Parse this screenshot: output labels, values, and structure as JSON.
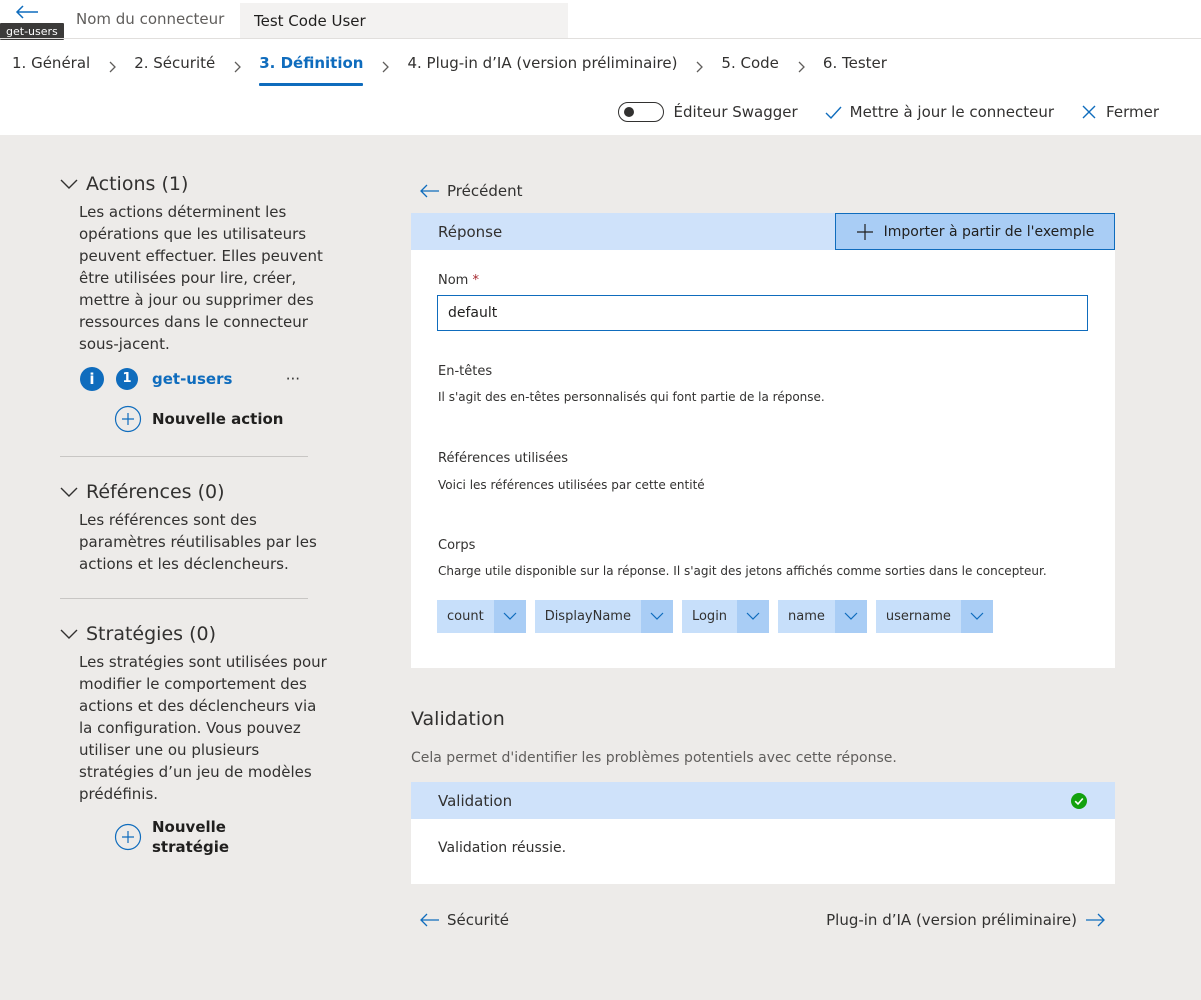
{
  "header": {
    "tooltip": "get-users",
    "connector_name_label": "Nom du connecteur",
    "connector_name_value": "Test Code User"
  },
  "steps": [
    {
      "label": "1. Général",
      "active": false
    },
    {
      "label": "2. Sécurité",
      "active": false
    },
    {
      "label": "3. Définition",
      "active": true
    },
    {
      "label": "4. Plug-in d’IA (version préliminaire)",
      "active": false
    },
    {
      "label": "5. Code",
      "active": false
    },
    {
      "label": "6. Tester",
      "active": false
    }
  ],
  "toolbar": {
    "swagger_label": "Éditeur Swagger",
    "update_label": "Mettre à jour le connecteur",
    "close_label": "Fermer"
  },
  "left": {
    "actions_title": "Actions (1)",
    "actions_desc": "Les actions déterminent les opérations que les utilisateurs peuvent effectuer. Elles peuvent être utilisées pour lire, créer, mettre à jour ou supprimer des ressources dans le connecteur sous-jacent.",
    "action_item_index": "1",
    "action_item_label": "get-users",
    "action_item_more": "···",
    "new_action_label": "Nouvelle action",
    "references_title": "Références (0)",
    "references_desc": "Les références sont des paramètres réutilisables par les actions et les déclencheurs.",
    "policies_title": "Stratégies (0)",
    "policies_desc": "Les stratégies sont utilisées pour modifier le comportement des actions et des déclencheurs via la configuration. Vous pouvez utiliser une ou plusieurs stratégies d’un jeu de modèles prédéfinis.",
    "new_policy_line1": "Nouvelle",
    "new_policy_line2": "stratégie"
  },
  "main": {
    "back_label": "Précédent",
    "response_header": "Réponse",
    "import_button": "Importer à partir de l'exemple",
    "name_label": "Nom",
    "required_mark": "*",
    "name_value": "default",
    "headers_title": "En-têtes",
    "headers_desc": "Il s'agit des en-têtes personnalisés qui font partie de la réponse.",
    "refs_title": "Références utilisées",
    "refs_desc": "Voici les références utilisées par cette entité",
    "body_title": "Corps",
    "body_desc": "Charge utile disponible sur la réponse. Il s'agit des jetons affichés comme sorties dans le concepteur.",
    "body_fields": [
      "count",
      "DisplayName",
      "Login",
      "name",
      "username"
    ],
    "validation_title": "Validation",
    "validation_desc": "Cela permet d'identifier les problèmes potentiels avec cette réponse.",
    "validation_header": "Validation",
    "validation_result": "Validation réussie.",
    "prev_link": "Sécurité",
    "next_link": "Plug-in d’IA (version préliminaire)"
  },
  "colors": {
    "accent": "#0f6cbd",
    "panel_header": "#cfe2fa",
    "success": "#13a10e",
    "background": "#edebe9"
  }
}
